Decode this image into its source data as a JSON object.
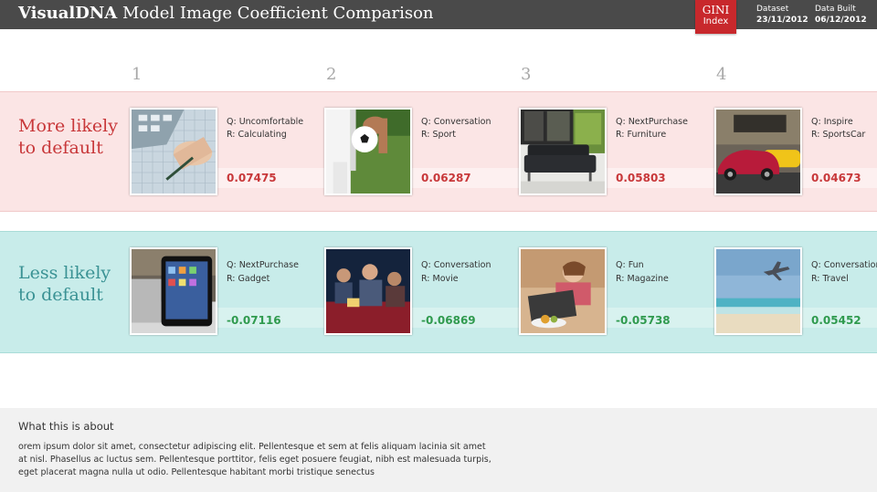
{
  "header": {
    "title_brand": "VisualDNA",
    "title_rest": "Model Image Coefficient Comparison",
    "gini_line1": "GINI",
    "gini_line2": "Index",
    "dataset_label": "Dataset",
    "dataset_date": "23/11/2012",
    "built_label": "Data Built",
    "built_date": "06/12/2012",
    "colors": {
      "header_bg": "#4a4a4a",
      "gini_bg": "#c8282c"
    }
  },
  "columns": [
    "1",
    "2",
    "3",
    "4"
  ],
  "more": {
    "label": "More likely\nto default",
    "color": "#c8383a",
    "items": [
      {
        "q": "Q: Uncomfortable",
        "r": "R: Calculating",
        "coef": "0.07475",
        "image": "calculator-image"
      },
      {
        "q": "Q: Conversation",
        "r": "R: Sport",
        "coef": "0.06287",
        "image": "football-image"
      },
      {
        "q": "Q: NextPurchase",
        "r": "R: Furniture",
        "coef": "0.05803",
        "image": "sofa-image"
      },
      {
        "q": "Q: Inspire",
        "r": "R: SportsCar",
        "coef": "0.04673",
        "image": "sports-car-image"
      }
    ]
  },
  "less": {
    "label": "Less likely\nto default",
    "color": "#3a9294",
    "items": [
      {
        "q": "Q: NextPurchase",
        "r": "R: Gadget",
        "coef": "-0.07116",
        "image": "tablet-image"
      },
      {
        "q": "Q: Conversation",
        "r": "R: Movie",
        "coef": "-0.06869",
        "image": "cinema-image"
      },
      {
        "q": "Q: Fun",
        "r": "R: Magazine",
        "coef": "-0.05738",
        "image": "magazine-image"
      },
      {
        "q": "Q: Conversation",
        "r": "R: Travel",
        "coef": "0.05452",
        "image": "beach-plane-image"
      }
    ]
  },
  "about": {
    "title": "What this is about",
    "body": "orem ipsum dolor sit amet, consectetur adipiscing elit. Pellentesque et sem at felis aliquam lacinia sit amet at nisl. Phasellus ac luctus sem. Pellentesque porttitor, felis eget posuere feugiat, nibh est malesuada turpis, eget placerat magna nulla ut odio. Pellentesque habitant morbi tristique senectus"
  }
}
